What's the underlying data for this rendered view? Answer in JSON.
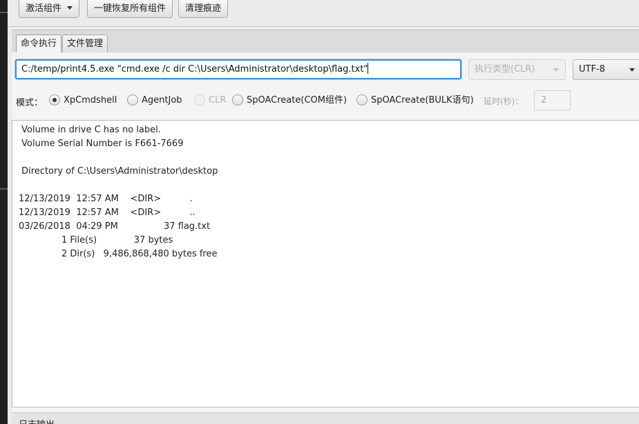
{
  "toolbar": {
    "activate_label": "激活组件",
    "restore_label": "一键恢复所有组件",
    "clean_label": "清理痕迹"
  },
  "tabs": [
    {
      "label": "命令执行",
      "active": true
    },
    {
      "label": "文件管理",
      "active": false
    }
  ],
  "command": {
    "value": "C:/temp/print4.5.exe \"cmd.exe /c dir C:\\Users\\Administrator\\desktop\\flag.txt\""
  },
  "exec_type": {
    "placeholder": "执行类型(CLR)"
  },
  "encoding": {
    "value": "UTF-8"
  },
  "mode": {
    "label": "模式：",
    "options": [
      {
        "label": "XpCmdshell",
        "checked": true,
        "disabled": false
      },
      {
        "label": "AgentJob",
        "checked": false,
        "disabled": false
      },
      {
        "label": "CLR",
        "checked": false,
        "disabled": true
      },
      {
        "label": "SpOACreate(COM组件)",
        "checked": false,
        "disabled": false
      },
      {
        "label": "SpOACreate(BULK语句)",
        "checked": false,
        "disabled": false
      }
    ],
    "delay_label": "延时(秒)：",
    "delay_value": "2"
  },
  "output": {
    "lines": [
      " Volume in drive C has no label.",
      " Volume Serial Number is F661-7669",
      "",
      " Directory of C:\\Users\\Administrator\\desktop",
      "",
      "12/13/2019  12:57 AM    <DIR>          .",
      "12/13/2019  12:57 AM    <DIR>          ..",
      "03/26/2018  04:29 PM                37 flag.txt",
      "               1 File(s)             37 bytes",
      "               2 Dir(s)   9,486,868,480 bytes free"
    ]
  },
  "log": {
    "label": "日志输出"
  }
}
